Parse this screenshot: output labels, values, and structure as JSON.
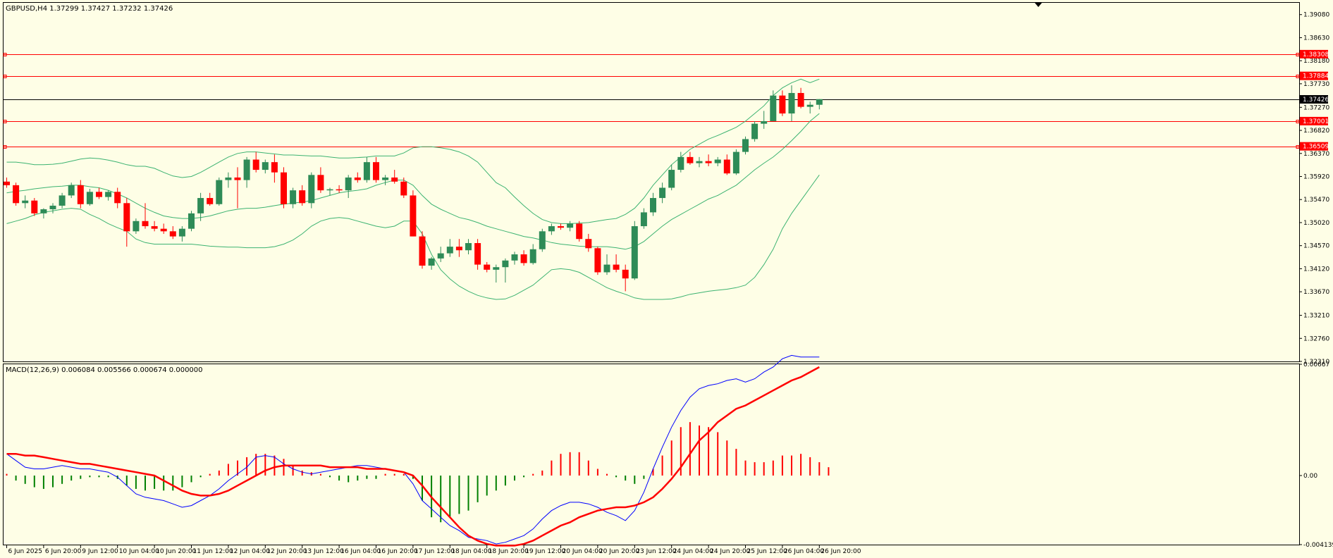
{
  "main_panel": {
    "title": "GBPUSD,H4  1.37299 1.37427 1.37232 1.37426"
  },
  "macd_panel": {
    "title": "MACD(12,26,9) 0.006084 0.005566 0.000674 0.000000"
  },
  "colors": {
    "background": "#fefee6",
    "bull_candle": "#2e8b57",
    "bear_candle": "#ff0000",
    "bollinger": "#3cb371",
    "level_line": "#ff0000",
    "current_price_line": "#000000",
    "macd_line": "#0000ff",
    "signal_line": "#ff0000",
    "hist_positive": "#ff0000",
    "hist_negative": "#008000"
  },
  "chart_data": [
    {
      "type": "candlestick",
      "symbol": "GBPUSD",
      "timeframe": "H4",
      "ylim": [
        1.3231,
        1.3931
      ],
      "y_ticks": [
        "1.39080",
        "1.38630",
        "1.38180",
        "1.37730",
        "1.37270",
        "1.36820",
        "1.36370",
        "1.35920",
        "1.35470",
        "1.35020",
        "1.34570",
        "1.34120",
        "1.33670",
        "1.33210",
        "1.32760",
        "1.32310"
      ],
      "x_ticks": [
        "6 Jun 2025",
        "6 Jun 20:00",
        "9 Jun 12:00",
        "10 Jun 04:00",
        "10 Jun 20:00",
        "11 Jun 12:00",
        "12 Jun 04:00",
        "12 Jun 20:00",
        "13 Jun 12:00",
        "16 Jun 04:00",
        "16 Jun 20:00",
        "17 Jun 12:00",
        "18 Jun 04:00",
        "18 Jun 20:00",
        "19 Jun 12:00",
        "20 Jun 04:00",
        "20 Jun 20:00",
        "23 Jun 12:00",
        "24 Jun 04:00",
        "24 Jun 20:00",
        "25 Jun 12:00",
        "26 Jun 04:00",
        "26 Jun 20:00"
      ],
      "candles": [
        [
          1.3582,
          1.359,
          1.357,
          1.3575
        ],
        [
          1.3575,
          1.358,
          1.3535,
          1.354
        ],
        [
          1.354,
          1.3555,
          1.353,
          1.3545
        ],
        [
          1.3545,
          1.355,
          1.3515,
          1.352
        ],
        [
          1.352,
          1.353,
          1.351,
          1.3528
        ],
        [
          1.3528,
          1.354,
          1.352,
          1.3535
        ],
        [
          1.3535,
          1.356,
          1.353,
          1.3555
        ],
        [
          1.3555,
          1.358,
          1.355,
          1.3575
        ],
        [
          1.3575,
          1.3585,
          1.353,
          1.3538
        ],
        [
          1.3538,
          1.3568,
          1.3535,
          1.3562
        ],
        [
          1.3562,
          1.357,
          1.3548,
          1.3552
        ],
        [
          1.3552,
          1.3565,
          1.3545,
          1.3562
        ],
        [
          1.3562,
          1.357,
          1.353,
          1.354
        ],
        [
          1.354,
          1.355,
          1.3455,
          1.3485
        ],
        [
          1.3485,
          1.351,
          1.348,
          1.3505
        ],
        [
          1.3505,
          1.354,
          1.349,
          1.3495
        ],
        [
          1.3495,
          1.3505,
          1.3485,
          1.349
        ],
        [
          1.349,
          1.35,
          1.348,
          1.3485
        ],
        [
          1.3485,
          1.3495,
          1.347,
          1.3475
        ],
        [
          1.3475,
          1.3495,
          1.3465,
          1.349
        ],
        [
          1.349,
          1.3525,
          1.3485,
          1.352
        ],
        [
          1.352,
          1.356,
          1.3505,
          1.355
        ],
        [
          1.355,
          1.356,
          1.3535,
          1.3538
        ],
        [
          1.3538,
          1.359,
          1.3535,
          1.3585
        ],
        [
          1.3585,
          1.36,
          1.357,
          1.359
        ],
        [
          1.359,
          1.361,
          1.353,
          1.3585
        ],
        [
          1.3585,
          1.363,
          1.357,
          1.3625
        ],
        [
          1.3625,
          1.364,
          1.36,
          1.3605
        ],
        [
          1.3605,
          1.3625,
          1.3598,
          1.362
        ],
        [
          1.362,
          1.3635,
          1.358,
          1.36
        ],
        [
          1.36,
          1.361,
          1.353,
          1.3538
        ],
        [
          1.3538,
          1.357,
          1.353,
          1.3565
        ],
        [
          1.3565,
          1.3575,
          1.3535,
          1.354
        ],
        [
          1.354,
          1.36,
          1.353,
          1.3595
        ],
        [
          1.3595,
          1.361,
          1.356,
          1.3565
        ],
        [
          1.3565,
          1.357,
          1.3555,
          1.3567
        ],
        [
          1.3567,
          1.3575,
          1.356,
          1.3565
        ],
        [
          1.3565,
          1.3595,
          1.355,
          1.359
        ],
        [
          1.359,
          1.36,
          1.358,
          1.3585
        ],
        [
          1.3585,
          1.363,
          1.358,
          1.362
        ],
        [
          1.362,
          1.363,
          1.358,
          1.3585
        ],
        [
          1.3585,
          1.3595,
          1.3575,
          1.359
        ],
        [
          1.359,
          1.3605,
          1.3578,
          1.3582
        ],
        [
          1.3582,
          1.359,
          1.355,
          1.3555
        ],
        [
          1.3555,
          1.3565,
          1.3475,
          1.3475
        ],
        [
          1.3475,
          1.3485,
          1.3412,
          1.3418
        ],
        [
          1.3418,
          1.3435,
          1.341,
          1.3432
        ],
        [
          1.3432,
          1.3455,
          1.3425,
          1.3442
        ],
        [
          1.3442,
          1.347,
          1.3435,
          1.3455
        ],
        [
          1.3455,
          1.347,
          1.3435,
          1.3448
        ],
        [
          1.3448,
          1.347,
          1.344,
          1.3462
        ],
        [
          1.3462,
          1.347,
          1.341,
          1.342
        ],
        [
          1.342,
          1.3425,
          1.3405,
          1.341
        ],
        [
          1.341,
          1.342,
          1.3385,
          1.3415
        ],
        [
          1.3415,
          1.3432,
          1.3385,
          1.3428
        ],
        [
          1.3428,
          1.3445,
          1.342,
          1.344
        ],
        [
          1.344,
          1.3448,
          1.3418,
          1.3423
        ],
        [
          1.3423,
          1.346,
          1.342,
          1.345
        ],
        [
          1.345,
          1.349,
          1.3445,
          1.3485
        ],
        [
          1.3485,
          1.35,
          1.3478,
          1.3495
        ],
        [
          1.3495,
          1.35,
          1.3488,
          1.3492
        ],
        [
          1.3492,
          1.3505,
          1.3485,
          1.35
        ],
        [
          1.35,
          1.3505,
          1.3465,
          1.347
        ],
        [
          1.347,
          1.348,
          1.3445,
          1.3452
        ],
        [
          1.3452,
          1.3455,
          1.34,
          1.3405
        ],
        [
          1.3405,
          1.344,
          1.34,
          1.342
        ],
        [
          1.342,
          1.344,
          1.3405,
          1.341
        ],
        [
          1.341,
          1.342,
          1.3368,
          1.3393
        ],
        [
          1.3393,
          1.3505,
          1.339,
          1.3495
        ],
        [
          1.3495,
          1.353,
          1.349,
          1.3522
        ],
        [
          1.3522,
          1.356,
          1.3515,
          1.355
        ],
        [
          1.355,
          1.358,
          1.354,
          1.357
        ],
        [
          1.357,
          1.3615,
          1.3565,
          1.3605
        ],
        [
          1.3605,
          1.364,
          1.36,
          1.363
        ],
        [
          1.363,
          1.364,
          1.3615,
          1.3618
        ],
        [
          1.3618,
          1.363,
          1.361,
          1.3622
        ],
        [
          1.3622,
          1.3635,
          1.3612,
          1.3618
        ],
        [
          1.3618,
          1.363,
          1.3612,
          1.3625
        ],
        [
          1.3625,
          1.3635,
          1.3595,
          1.3598
        ],
        [
          1.3598,
          1.3645,
          1.3595,
          1.364
        ],
        [
          1.364,
          1.367,
          1.3635,
          1.3665
        ],
        [
          1.3665,
          1.37,
          1.366,
          1.3695
        ],
        [
          1.3695,
          1.372,
          1.3685,
          1.37
        ],
        [
          1.37,
          1.376,
          1.37,
          1.375
        ],
        [
          1.375,
          1.376,
          1.371,
          1.3715
        ],
        [
          1.3715,
          1.377,
          1.37,
          1.3755
        ],
        [
          1.3755,
          1.3765,
          1.3725,
          1.3728
        ],
        [
          1.3728,
          1.3738,
          1.3715,
          1.3732
        ],
        [
          1.3732,
          1.3743,
          1.3723,
          1.3743
        ]
      ],
      "bollinger_bands": {
        "upper": [
          1.362,
          1.362,
          1.3618,
          1.3615,
          1.3615,
          1.3616,
          1.3618,
          1.3622,
          1.3626,
          1.3628,
          1.3627,
          1.3624,
          1.362,
          1.3615,
          1.3612,
          1.3612,
          1.3608,
          1.36,
          1.3593,
          1.359,
          1.3592,
          1.36,
          1.361,
          1.362,
          1.363,
          1.3637,
          1.364,
          1.364,
          1.3638,
          1.3636,
          1.3634,
          1.3634,
          1.3633,
          1.3632,
          1.3632,
          1.363,
          1.3628,
          1.3628,
          1.3629,
          1.363,
          1.3632,
          1.3632,
          1.3632,
          1.3638,
          1.3648,
          1.365,
          1.365,
          1.3648,
          1.3645,
          1.364,
          1.3632,
          1.362,
          1.36,
          1.358,
          1.357,
          1.3552,
          1.3535,
          1.352,
          1.3508,
          1.3502,
          1.35,
          1.35,
          1.3501,
          1.3502,
          1.3505,
          1.3508,
          1.351,
          1.3518,
          1.353,
          1.355,
          1.3575,
          1.3595,
          1.3615,
          1.363,
          1.3645,
          1.3655,
          1.3665,
          1.3672,
          1.368,
          1.3688,
          1.37,
          1.3715,
          1.373,
          1.375,
          1.3765,
          1.3775,
          1.3782,
          1.3775,
          1.3782
        ],
        "middle": [
          1.356,
          1.3563,
          1.3565,
          1.3568,
          1.357,
          1.3572,
          1.3573,
          1.3575,
          1.3575,
          1.3572,
          1.357,
          1.3565,
          1.3558,
          1.355,
          1.354,
          1.353,
          1.3522,
          1.3515,
          1.3512,
          1.351,
          1.351,
          1.3512,
          1.3515,
          1.352,
          1.3525,
          1.3528,
          1.353,
          1.353,
          1.3532,
          1.3535,
          1.3538,
          1.354,
          1.3542,
          1.3545,
          1.355,
          1.3555,
          1.356,
          1.3563,
          1.3565,
          1.3568,
          1.3575,
          1.358,
          1.3585,
          1.3585,
          1.3575,
          1.3555,
          1.3538,
          1.3528,
          1.352,
          1.3512,
          1.3508,
          1.3502,
          1.3495,
          1.349,
          1.3485,
          1.348,
          1.3475,
          1.3472,
          1.3468,
          1.3463,
          1.346,
          1.3458,
          1.3456,
          1.3455,
          1.3455,
          1.3455,
          1.3453,
          1.345,
          1.3455,
          1.3465,
          1.348,
          1.3495,
          1.3508,
          1.3518,
          1.3528,
          1.3538,
          1.3548,
          1.3555,
          1.3565,
          1.3575,
          1.359,
          1.3605,
          1.3618,
          1.363,
          1.3645,
          1.3662,
          1.368,
          1.37,
          1.3715
        ],
        "lower": [
          1.35,
          1.3505,
          1.351,
          1.3517,
          1.3522,
          1.3525,
          1.3528,
          1.353,
          1.3528,
          1.3518,
          1.351,
          1.35,
          1.3492,
          1.3485,
          1.347,
          1.3463,
          1.346,
          1.346,
          1.346,
          1.346,
          1.346,
          1.3458,
          1.3456,
          1.3455,
          1.3454,
          1.3454,
          1.3453,
          1.3453,
          1.3453,
          1.3455,
          1.346,
          1.3468,
          1.348,
          1.3495,
          1.3505,
          1.351,
          1.3512,
          1.351,
          1.3505,
          1.35,
          1.3495,
          1.3492,
          1.3495,
          1.3505,
          1.3505,
          1.348,
          1.344,
          1.341,
          1.3392,
          1.3378,
          1.3368,
          1.336,
          1.3355,
          1.3352,
          1.3353,
          1.336,
          1.337,
          1.338,
          1.3395,
          1.341,
          1.3412,
          1.341,
          1.3405,
          1.3395,
          1.3385,
          1.3375,
          1.3368,
          1.3362,
          1.3355,
          1.3352,
          1.3352,
          1.3352,
          1.3353,
          1.3357,
          1.3362,
          1.3365,
          1.3368,
          1.337,
          1.3372,
          1.3375,
          1.338,
          1.3395,
          1.342,
          1.345,
          1.349,
          1.352,
          1.3545,
          1.357,
          1.3595
        ]
      },
      "horizontal_levels": [
        "1.38308",
        "1.37884",
        "1.37001",
        "1.36509"
      ],
      "current_price": "1.37426"
    },
    {
      "type": "macd",
      "params": "(12,26,9)",
      "ylim": [
        -0.004139,
        0.00667
      ],
      "y_ticks": [
        "0.00667",
        "0.00",
        "-0.004139"
      ],
      "histogram": [
        0.0001,
        -0.0003,
        -0.0005,
        -0.0007,
        -0.0008,
        -0.0007,
        -0.0005,
        -0.0003,
        -0.0002,
        -0.0001,
        -0.0001,
        -0.0001,
        -0.0002,
        -0.0006,
        -0.0008,
        -0.0009,
        -0.0008,
        -0.0009,
        -0.0009,
        -0.0007,
        -0.0004,
        -0.0001,
        0.0001,
        0.0003,
        0.0007,
        0.0009,
        0.0011,
        0.0013,
        0.0013,
        0.0012,
        0.001,
        0.0006,
        0.0003,
        0.0002,
        0.0001,
        -0.0001,
        -0.0003,
        -0.0004,
        -0.0003,
        -0.0002,
        -0.0002,
        0.0001,
        0.0001,
        0.0001,
        -0.0002,
        -0.0015,
        -0.0025,
        -0.0028,
        -0.0025,
        -0.0023,
        -0.0021,
        -0.0016,
        -0.0012,
        -0.0009,
        -0.0006,
        -0.0003,
        -0.0001,
        0.0001,
        0.0003,
        0.0009,
        0.0013,
        0.0014,
        0.0014,
        0.0009,
        0.0004,
        0.0001,
        -0.0001,
        -0.0003,
        -0.0005,
        -0.0002,
        0.0004,
        0.0012,
        0.0021,
        0.0029,
        0.0032,
        0.003,
        0.0029,
        0.0026,
        0.0021,
        0.0016,
        0.0009,
        0.0008,
        0.0008,
        0.0009,
        0.0012,
        0.0012,
        0.0013,
        0.0011,
        0.0008,
        0.0005
      ],
      "macd_line": [
        0.0013,
        0.0009,
        0.0005,
        0.0004,
        0.0004,
        0.0005,
        0.0006,
        0.0005,
        0.0004,
        0.0004,
        0.0003,
        0.0002,
        -0.0001,
        -0.0006,
        -0.0011,
        -0.0013,
        -0.0014,
        -0.0015,
        -0.0017,
        -0.0019,
        -0.0018,
        -0.0015,
        -0.0012,
        -0.0008,
        -0.0003,
        0.0001,
        0.0005,
        0.0011,
        0.0012,
        0.0011,
        0.0007,
        0.0004,
        0.0002,
        0.0001,
        0.0002,
        0.0003,
        0.0004,
        0.0005,
        0.0006,
        0.0006,
        0.0005,
        0.0004,
        0.0003,
        0.0002,
        -0.0005,
        -0.0015,
        -0.002,
        -0.0025,
        -0.003,
        -0.0033,
        -0.0037,
        -0.0038,
        -0.0039,
        -0.0041,
        -0.004,
        -0.0038,
        -0.0036,
        -0.0032,
        -0.0026,
        -0.0021,
        -0.0018,
        -0.0016,
        -0.0016,
        -0.0017,
        -0.0019,
        -0.0022,
        -0.0024,
        -0.0027,
        -0.0021,
        -0.001,
        0.0004,
        0.0017,
        0.0029,
        0.0039,
        0.0047,
        0.0052,
        0.0054,
        0.0055,
        0.0057,
        0.0058,
        0.0056,
        0.0058,
        0.0062,
        0.0065,
        0.007,
        0.0072,
        0.0071,
        0.0071,
        0.0071
      ],
      "signal_line": [
        0.0013,
        0.0013,
        0.0012,
        0.0012,
        0.0011,
        0.001,
        0.0009,
        0.0008,
        0.0007,
        0.0007,
        0.0006,
        0.0005,
        0.0004,
        0.0003,
        0.0002,
        0.0001,
        0.0,
        -0.0003,
        -0.0006,
        -0.0009,
        -0.0011,
        -0.0012,
        -0.0012,
        -0.0011,
        -0.0009,
        -0.0006,
        -0.0003,
        0.0,
        0.0003,
        0.0005,
        0.0006,
        0.0006,
        0.0006,
        0.0006,
        0.0006,
        0.0005,
        0.0005,
        0.0005,
        0.0005,
        0.0004,
        0.0004,
        0.0004,
        0.0003,
        0.0002,
        0.0,
        -0.0006,
        -0.0013,
        -0.0019,
        -0.0025,
        -0.0031,
        -0.0036,
        -0.0039,
        -0.0041,
        -0.0042,
        -0.0042,
        -0.0042,
        -0.0041,
        -0.0039,
        -0.0036,
        -0.0033,
        -0.003,
        -0.0028,
        -0.0025,
        -0.0023,
        -0.0021,
        -0.002,
        -0.0019,
        -0.0019,
        -0.0018,
        -0.0016,
        -0.0013,
        -0.0008,
        -0.0002,
        0.0005,
        0.0013,
        0.0021,
        0.0026,
        0.0032,
        0.0036,
        0.004,
        0.0042,
        0.0045,
        0.0048,
        0.0051,
        0.0054,
        0.0057,
        0.0059,
        0.0062,
        0.0065
      ]
    }
  ]
}
